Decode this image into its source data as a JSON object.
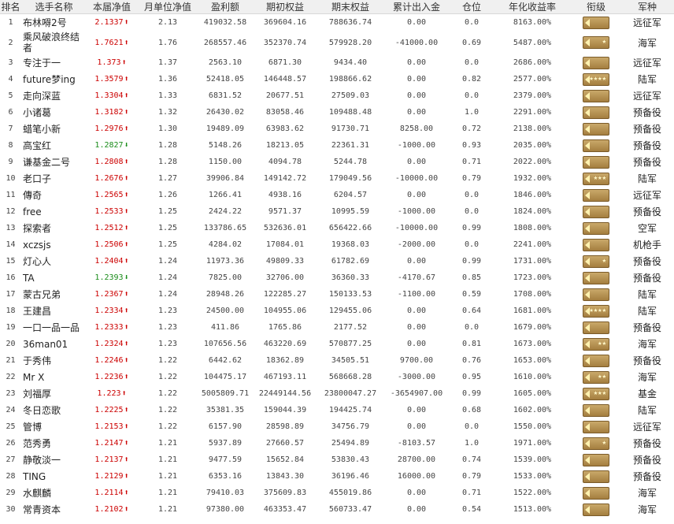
{
  "headers": [
    "排名",
    "选手名称",
    "本届净值",
    "月单位净值",
    "盈利额",
    "期初权益",
    "期末权益",
    "累计出入金",
    "仓位",
    "年化收益率",
    "衔级",
    "军种"
  ],
  "rows": [
    {
      "rank": "1",
      "name": "布林嘚2号",
      "cur": "2.1337",
      "dir": "up",
      "month": "2.13",
      "profit": "419032.58",
      "start": "369604.16",
      "end": "788636.74",
      "flow": "0.00",
      "pos": "0.0",
      "annual": "8163.00%",
      "rank_stars": "",
      "type": "远征军"
    },
    {
      "rank": "2",
      "name": "乘风破浪终结者",
      "cur": "1.7621",
      "dir": "up",
      "month": "1.76",
      "profit": "268557.46",
      "start": "352370.74",
      "end": "579928.20",
      "flow": "-41000.00",
      "pos": "0.69",
      "annual": "5487.00%",
      "rank_stars": "★",
      "type": "海军"
    },
    {
      "rank": "3",
      "name": "专注于一",
      "cur": "1.373",
      "dir": "up",
      "month": "1.37",
      "profit": "2563.10",
      "start": "6871.30",
      "end": "9434.40",
      "flow": "0.00",
      "pos": "0.0",
      "annual": "2686.00%",
      "rank_stars": "",
      "type": "远征军"
    },
    {
      "rank": "4",
      "name": "future梦ing",
      "cur": "1.3579",
      "dir": "up",
      "month": "1.36",
      "profit": "52418.05",
      "start": "146448.57",
      "end": "198866.62",
      "flow": "0.00",
      "pos": "0.82",
      "annual": "2577.00%",
      "rank_stars": "★★★★",
      "type": "陆军"
    },
    {
      "rank": "5",
      "name": "走向深蓝",
      "cur": "1.3304",
      "dir": "up",
      "month": "1.33",
      "profit": "6831.52",
      "start": "20677.51",
      "end": "27509.03",
      "flow": "0.00",
      "pos": "0.0",
      "annual": "2379.00%",
      "rank_stars": "",
      "type": "远征军"
    },
    {
      "rank": "6",
      "name": "小诸葛",
      "cur": "1.3182",
      "dir": "up",
      "month": "1.32",
      "profit": "26430.02",
      "start": "83058.46",
      "end": "109488.48",
      "flow": "0.00",
      "pos": "1.0",
      "annual": "2291.00%",
      "rank_stars": "",
      "type": "预备役"
    },
    {
      "rank": "7",
      "name": "蜡笔小新",
      "cur": "1.2976",
      "dir": "up",
      "month": "1.30",
      "profit": "19489.09",
      "start": "63983.62",
      "end": "91730.71",
      "flow": "8258.00",
      "pos": "0.72",
      "annual": "2138.00%",
      "rank_stars": "",
      "type": "预备役"
    },
    {
      "rank": "8",
      "name": "高宝红",
      "cur": "1.2827",
      "dir": "down",
      "month": "1.28",
      "profit": "5148.26",
      "start": "18213.05",
      "end": "22361.31",
      "flow": "-1000.00",
      "pos": "0.93",
      "annual": "2035.00%",
      "rank_stars": "",
      "type": "预备役"
    },
    {
      "rank": "9",
      "name": "谦基金二号",
      "cur": "1.2808",
      "dir": "up",
      "month": "1.28",
      "profit": "1150.00",
      "start": "4094.78",
      "end": "5244.78",
      "flow": "0.00",
      "pos": "0.71",
      "annual": "2022.00%",
      "rank_stars": "",
      "type": "预备役"
    },
    {
      "rank": "10",
      "name": "老口子",
      "cur": "1.2676",
      "dir": "up",
      "month": "1.27",
      "profit": "39906.84",
      "start": "149142.72",
      "end": "179049.56",
      "flow": "-10000.00",
      "pos": "0.79",
      "annual": "1932.00%",
      "rank_stars": "★★★",
      "type": "陆军"
    },
    {
      "rank": "11",
      "name": "傳奇",
      "cur": "1.2565",
      "dir": "up",
      "month": "1.26",
      "profit": "1266.41",
      "start": "4938.16",
      "end": "6204.57",
      "flow": "0.00",
      "pos": "0.0",
      "annual": "1846.00%",
      "rank_stars": "",
      "type": "远征军"
    },
    {
      "rank": "12",
      "name": "free",
      "cur": "1.2533",
      "dir": "up",
      "month": "1.25",
      "profit": "2424.22",
      "start": "9571.37",
      "end": "10995.59",
      "flow": "-1000.00",
      "pos": "0.0",
      "annual": "1824.00%",
      "rank_stars": "",
      "type": "预备役"
    },
    {
      "rank": "13",
      "name": "探索者",
      "cur": "1.2512",
      "dir": "up",
      "month": "1.25",
      "profit": "133786.65",
      "start": "532636.01",
      "end": "656422.66",
      "flow": "-10000.00",
      "pos": "0.99",
      "annual": "1808.00%",
      "rank_stars": "",
      "type": "空军"
    },
    {
      "rank": "14",
      "name": "xczsjs",
      "cur": "1.2506",
      "dir": "up",
      "month": "1.25",
      "profit": "4284.02",
      "start": "17084.01",
      "end": "19368.03",
      "flow": "-2000.00",
      "pos": "0.0",
      "annual": "2241.00%",
      "rank_stars": "",
      "type": "机枪手"
    },
    {
      "rank": "15",
      "name": "灯心人",
      "cur": "1.2404",
      "dir": "up",
      "month": "1.24",
      "profit": "11973.36",
      "start": "49809.33",
      "end": "61782.69",
      "flow": "0.00",
      "pos": "0.99",
      "annual": "1731.00%",
      "rank_stars": "★",
      "type": "预备役"
    },
    {
      "rank": "16",
      "name": "TA",
      "cur": "1.2393",
      "dir": "down",
      "month": "1.24",
      "profit": "7825.00",
      "start": "32706.00",
      "end": "36360.33",
      "flow": "-4170.67",
      "pos": "0.85",
      "annual": "1723.00%",
      "rank_stars": "",
      "type": "预备役"
    },
    {
      "rank": "17",
      "name": "蒙古兄弟",
      "cur": "1.2367",
      "dir": "up",
      "month": "1.24",
      "profit": "28948.26",
      "start": "122285.27",
      "end": "150133.53",
      "flow": "-1100.00",
      "pos": "0.59",
      "annual": "1708.00%",
      "rank_stars": "",
      "type": "陆军"
    },
    {
      "rank": "18",
      "name": "王建昌",
      "cur": "1.2334",
      "dir": "up",
      "month": "1.23",
      "profit": "24500.00",
      "start": "104955.06",
      "end": "129455.06",
      "flow": "0.00",
      "pos": "0.64",
      "annual": "1681.00%",
      "rank_stars": "★★★★",
      "type": "陆军"
    },
    {
      "rank": "19",
      "name": "一口一品一品",
      "cur": "1.2333",
      "dir": "up",
      "month": "1.23",
      "profit": "411.86",
      "start": "1765.86",
      "end": "2177.52",
      "flow": "0.00",
      "pos": "0.0",
      "annual": "1679.00%",
      "rank_stars": "",
      "type": "预备役"
    },
    {
      "rank": "20",
      "name": "36man01",
      "cur": "1.2324",
      "dir": "up",
      "month": "1.23",
      "profit": "107656.56",
      "start": "463220.69",
      "end": "570877.25",
      "flow": "0.00",
      "pos": "0.81",
      "annual": "1673.00%",
      "rank_stars": "★★",
      "type": "海军"
    },
    {
      "rank": "21",
      "name": "于秀伟",
      "cur": "1.2246",
      "dir": "up",
      "month": "1.22",
      "profit": "6442.62",
      "start": "18362.89",
      "end": "34505.51",
      "flow": "9700.00",
      "pos": "0.76",
      "annual": "1653.00%",
      "rank_stars": "",
      "type": "预备役"
    },
    {
      "rank": "22",
      "name": "Mr X",
      "cur": "1.2236",
      "dir": "up",
      "month": "1.22",
      "profit": "104475.17",
      "start": "467193.11",
      "end": "568668.28",
      "flow": "-3000.00",
      "pos": "0.95",
      "annual": "1610.00%",
      "rank_stars": "★★",
      "type": "海军"
    },
    {
      "rank": "23",
      "name": "刘福厚",
      "cur": "1.223",
      "dir": "up",
      "month": "1.22",
      "profit": "5005809.71",
      "start": "22449144.56",
      "end": "23800047.27",
      "flow": "-3654907.00",
      "pos": "0.99",
      "annual": "1605.00%",
      "rank_stars": "★★★",
      "type": "基金"
    },
    {
      "rank": "24",
      "name": "冬日恋歌",
      "cur": "1.2225",
      "dir": "up",
      "month": "1.22",
      "profit": "35381.35",
      "start": "159044.39",
      "end": "194425.74",
      "flow": "0.00",
      "pos": "0.68",
      "annual": "1602.00%",
      "rank_stars": "",
      "type": "陆军"
    },
    {
      "rank": "25",
      "name": "管博",
      "cur": "1.2153",
      "dir": "up",
      "month": "1.22",
      "profit": "6157.90",
      "start": "28598.89",
      "end": "34756.79",
      "flow": "0.00",
      "pos": "0.0",
      "annual": "1550.00%",
      "rank_stars": "",
      "type": "远征军"
    },
    {
      "rank": "26",
      "name": "范秀勇",
      "cur": "1.2147",
      "dir": "up",
      "month": "1.21",
      "profit": "5937.89",
      "start": "27660.57",
      "end": "25494.89",
      "flow": "-8103.57",
      "pos": "1.0",
      "annual": "1971.00%",
      "rank_stars": "★",
      "type": "预备役"
    },
    {
      "rank": "27",
      "name": "静敬淡一",
      "cur": "1.2137",
      "dir": "up",
      "month": "1.21",
      "profit": "9477.59",
      "start": "15652.84",
      "end": "53830.43",
      "flow": "28700.00",
      "pos": "0.74",
      "annual": "1539.00%",
      "rank_stars": "",
      "type": "预备役"
    },
    {
      "rank": "28",
      "name": "TING",
      "cur": "1.2129",
      "dir": "up",
      "month": "1.21",
      "profit": "6353.16",
      "start": "13843.30",
      "end": "36196.46",
      "flow": "16000.00",
      "pos": "0.79",
      "annual": "1533.00%",
      "rank_stars": "",
      "type": "预备役"
    },
    {
      "rank": "29",
      "name": "水麒麟",
      "cur": "1.2114",
      "dir": "up",
      "month": "1.21",
      "profit": "79410.03",
      "start": "375609.83",
      "end": "455019.86",
      "flow": "0.00",
      "pos": "0.71",
      "annual": "1522.00%",
      "rank_stars": "",
      "type": "海军"
    },
    {
      "rank": "30",
      "name": "常青资本",
      "cur": "1.2102",
      "dir": "up",
      "month": "1.21",
      "profit": "97380.00",
      "start": "463353.47",
      "end": "560733.47",
      "flow": "0.00",
      "pos": "0.54",
      "annual": "1513.00%",
      "rank_stars": "",
      "type": "海军"
    }
  ],
  "icons": {
    "up_arrow": "⬆",
    "down_arrow": "⬇"
  },
  "colors": {
    "up": "#cc0000",
    "down": "#1a8c1a",
    "badge": "#b08a4a"
  }
}
